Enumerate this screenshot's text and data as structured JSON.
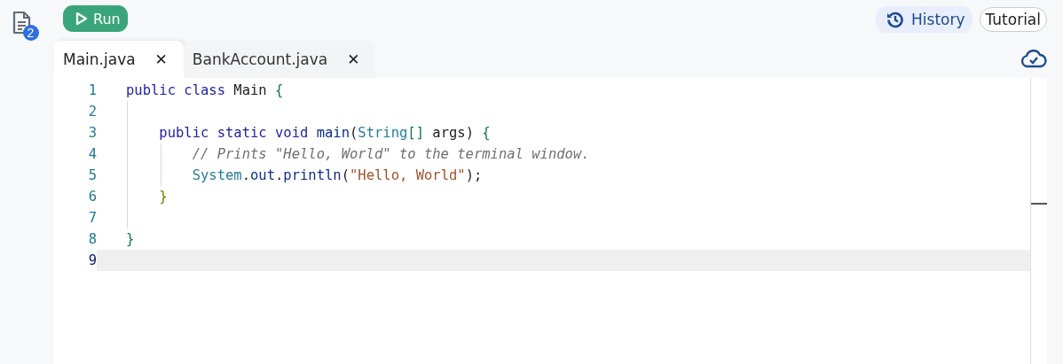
{
  "sidebar": {
    "files_badge": "2"
  },
  "toolbar": {
    "run_button": "Run",
    "history_button": "History",
    "tutorial_button": "Tutorial"
  },
  "tabs": [
    {
      "label": "Main.java",
      "selected": true,
      "close": "✕"
    },
    {
      "label": "BankAccount.java",
      "selected": false,
      "close": "✕"
    }
  ],
  "editor": {
    "lines": [
      {
        "number": "1",
        "current": false,
        "tokens": [
          {
            "text": "public class",
            "kind": "keyword"
          },
          {
            "text": " Main ",
            "kind": "plain"
          },
          {
            "text": "{",
            "kind": "brace"
          }
        ]
      },
      {
        "number": "2",
        "current": false
      },
      {
        "number": "3",
        "current": false,
        "tokens": [
          {
            "text": "    public static void ",
            "kind": "keyword"
          },
          {
            "text": "main",
            "kind": "member"
          },
          {
            "text": "(",
            "kind": "plain"
          },
          {
            "text": "String",
            "kind": "type"
          },
          {
            "text": "[]",
            "kind": "brace"
          },
          {
            "text": " args) ",
            "kind": "plain"
          },
          {
            "text": "{",
            "kind": "brace"
          }
        ]
      },
      {
        "number": "4",
        "current": false,
        "tokens": [
          {
            "text": "        // Prints \"Hello, World\" to the terminal window.",
            "kind": "comment"
          }
        ]
      },
      {
        "number": "5",
        "current": false,
        "tokens": [
          {
            "text": "        System",
            "kind": "type"
          },
          {
            "text": ".",
            "kind": "plain"
          },
          {
            "text": "out",
            "kind": "member"
          },
          {
            "text": ".",
            "kind": "plain"
          },
          {
            "text": "println",
            "kind": "member"
          },
          {
            "text": "(",
            "kind": "plain"
          },
          {
            "text": "\"Hello, World\"",
            "kind": "string"
          },
          {
            "text": ");",
            "kind": "plain"
          }
        ]
      },
      {
        "number": "6",
        "current": false,
        "tokens": [
          {
            "text": "    }",
            "kind": "brace2"
          }
        ]
      },
      {
        "number": "7",
        "current": false
      },
      {
        "number": "8",
        "current": false,
        "tokens": [
          {
            "text": "}",
            "kind": "brace"
          }
        ]
      },
      {
        "number": "9",
        "current": true
      }
    ]
  }
}
